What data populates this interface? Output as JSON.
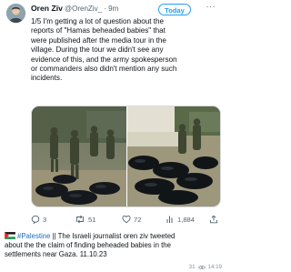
{
  "tweet": {
    "author_name": "Oren Ziv",
    "handle_time": "@OrenZiv_ · 9m",
    "badge": "Today",
    "text_lines": [
      "1/5 I'm getting a lot of question about the",
      "reports of \"Hamas beheaded babies\" that",
      "were published after the media tour in the",
      "village. During the tour we didn't see any",
      "evidence of this, and the army spokesperson",
      "or commanders also didn't mention any such",
      "incidents."
    ],
    "actions": {
      "replies": "3",
      "retweets": "51",
      "likes": "72",
      "views": "1,884"
    }
  },
  "message": {
    "hashtag": "#Palestine",
    "line1_rest": " || The Israeli journalist oren ziv tweeted",
    "line2": "about the the claim of finding beheaded babies in the",
    "line3": "settlements near Gaza. 11.10.23",
    "views": "31",
    "time": "14:19"
  },
  "colors": {
    "accent": "#1da1f2",
    "hashtag": "#1d6fbf",
    "muted": "#536471"
  }
}
